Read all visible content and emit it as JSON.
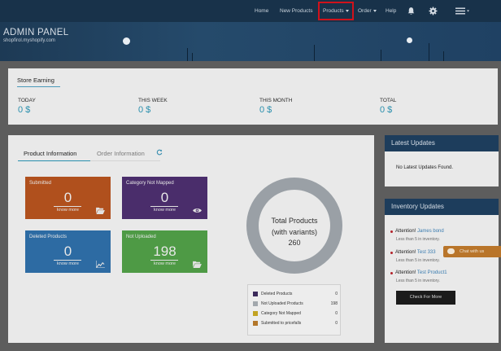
{
  "nav": {
    "home": "Home",
    "new_products": "New Products",
    "products": "Products",
    "order": "Order",
    "help": "Help"
  },
  "banner": {
    "title": "ADMIN PANEL",
    "subtitle": "shopfirol.myshopify.com"
  },
  "earning": {
    "title": "Store Earning",
    "items": [
      {
        "label": "TODAY",
        "value": "0 $"
      },
      {
        "label": "THIS WEEK",
        "value": "0 $"
      },
      {
        "label": "THIS MONTH",
        "value": "0 $"
      },
      {
        "label": "TOTAL",
        "value": "0 $"
      }
    ]
  },
  "tabs": {
    "product_info": "Product Information",
    "order_info": "Order Information"
  },
  "cards": [
    {
      "title": "Submitted",
      "value": "0",
      "link": "know more",
      "icon": "folder-open-icon",
      "color": "#b0501d"
    },
    {
      "title": "Category Not Mapped",
      "value": "0",
      "link": "know more",
      "icon": "eye-icon",
      "color": "#4a2d6b"
    },
    {
      "title": "Deleted Products",
      "value": "0",
      "link": "know more",
      "icon": "area-chart-icon",
      "color": "#2d6ba3"
    },
    {
      "title": "Not Uploaded",
      "value": "198",
      "link": "know more",
      "icon": "folder-open-icon",
      "color": "#4e9a45"
    }
  ],
  "donut": {
    "line1": "Total Products",
    "line2": "(with variants)",
    "total": "260"
  },
  "legend": [
    {
      "label": "Deleted Products",
      "value": "0",
      "color": "#3b2a5a"
    },
    {
      "label": "Not Uploaded Products",
      "value": "198",
      "color": "#a2a8ad"
    },
    {
      "label": "Category Not Mapped",
      "value": "0",
      "color": "#c2a323"
    },
    {
      "label": "Submitted to pricefalls",
      "value": "0",
      "color": "#b3772a"
    }
  ],
  "latest": {
    "title": "Latest Updates",
    "message": "No Latest Updates Found."
  },
  "inventory": {
    "title": "Inventory Updates",
    "items": [
      {
        "prefix": "Attention! ",
        "name": "James bond",
        "note": "Less than 5 in inventory."
      },
      {
        "prefix": "Attention! ",
        "name": "Test 333",
        "note": "Less than 5 in inventory."
      },
      {
        "prefix": "Attention! ",
        "name": "Test Product1",
        "note": "Less than 5 in inventory."
      }
    ],
    "button": "Check For More"
  },
  "chat": {
    "label": "Chat with us"
  }
}
